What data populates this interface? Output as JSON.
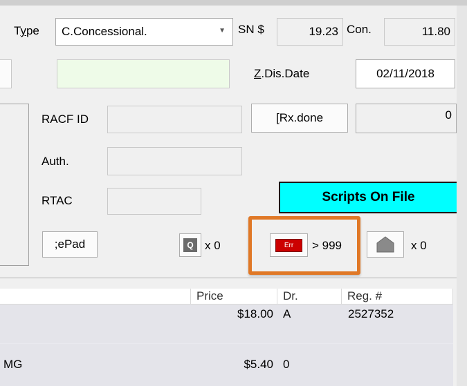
{
  "form": {
    "type_label": "Type",
    "type_value": "C.Concessional.",
    "sn_label": "SN $",
    "sn_value": "19.23",
    "con_label": "Con.",
    "con_value": "11.80",
    "zdis_label_u": "Z",
    "zdis_label_rest": ".Dis.Date",
    "zdis_value": "02/11/2018",
    "racf_label": "RACF ID",
    "rx_button_u": "[",
    "rx_button_rest": " Rx.done",
    "rx_count": "0",
    "auth_label": "Auth.",
    "rtac_label": "RTAC",
    "scripts_button": "Scripts On File",
    "epad_button_u": ";",
    "epad_button_rest": " ePad",
    "q_icon_text": "Q",
    "q_count": "x 0",
    "err_icon_text": "Err",
    "err_count": "> 999",
    "house_count": "x 0"
  },
  "grid": {
    "columns": [
      "Price",
      "Dr.",
      "Reg. #"
    ],
    "rows": [
      {
        "desc": "",
        "price": "$18.00",
        "dr": "A",
        "reg": "2527352"
      },
      {
        "desc": "MG",
        "price": "$5.40",
        "dr": "0",
        "reg": ""
      }
    ]
  },
  "colors": {
    "scripts_button_bg": "#00ffff",
    "highlight_border": "#e07826",
    "err_icon_bg": "#cc0000",
    "new_field_bg": "#eefbe8"
  }
}
